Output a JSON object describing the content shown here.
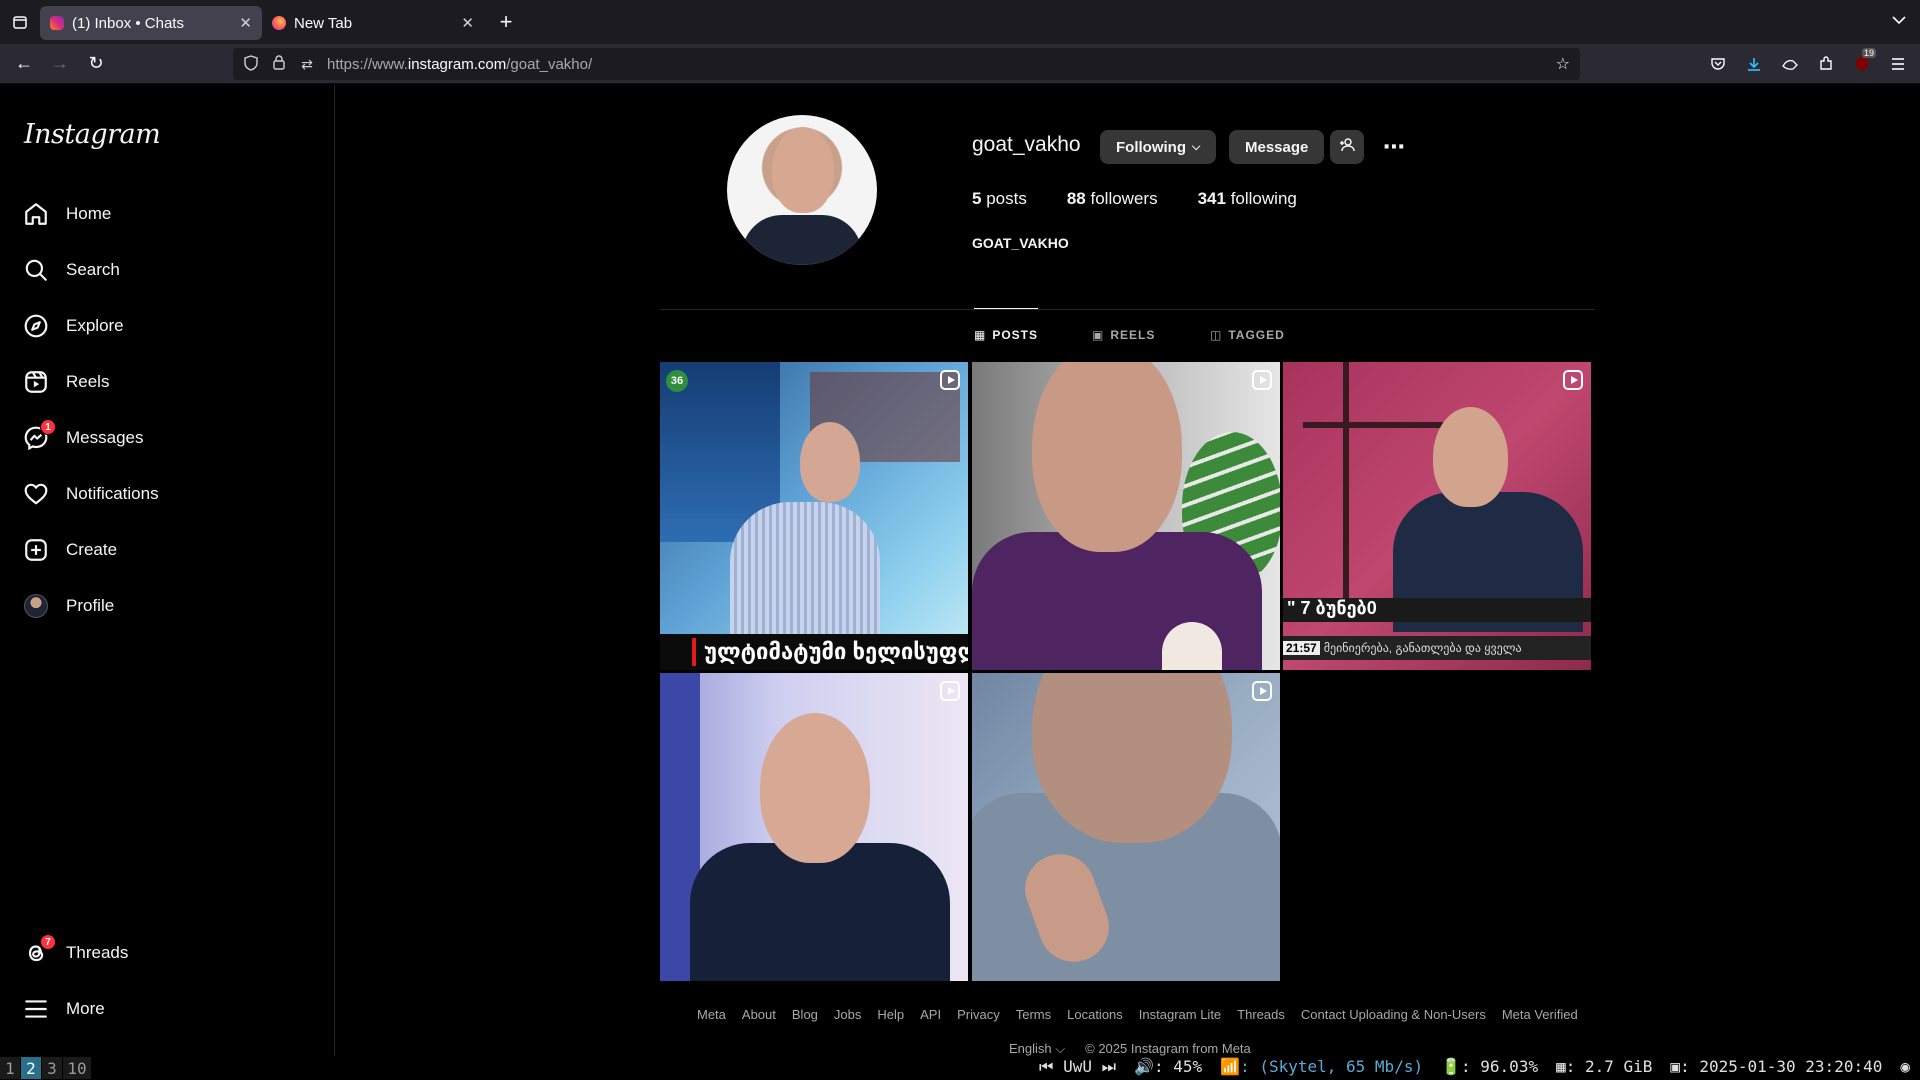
{
  "browser": {
    "tabs": [
      {
        "title": "(1) Inbox • Chats",
        "active": true
      },
      {
        "title": "New Tab",
        "active": false
      }
    ],
    "url_prefix": "https://www.",
    "url_domain": "instagram.com",
    "url_path": "/goat_vakho/",
    "extension_badge": "19"
  },
  "sidebar": {
    "logo": "Instagram",
    "items": [
      {
        "label": "Home",
        "icon": "home-icon"
      },
      {
        "label": "Search",
        "icon": "search-icon"
      },
      {
        "label": "Explore",
        "icon": "compass-icon"
      },
      {
        "label": "Reels",
        "icon": "reels-icon"
      },
      {
        "label": "Messages",
        "icon": "messenger-icon",
        "badge": "1"
      },
      {
        "label": "Notifications",
        "icon": "heart-icon"
      },
      {
        "label": "Create",
        "icon": "plus-square-icon"
      },
      {
        "label": "Profile",
        "icon": "profile-avatar"
      }
    ],
    "threads": {
      "label": "Threads",
      "badge": "7"
    },
    "more": {
      "label": "More"
    }
  },
  "profile": {
    "username": "goat_vakho",
    "following_btn": "Following",
    "message_btn": "Message",
    "posts_count": "5",
    "posts_label": "posts",
    "followers_count": "88",
    "followers_label": "followers",
    "following_count": "341",
    "following_label": "following",
    "full_name": "GOAT_VAKHO"
  },
  "profile_tabs": [
    {
      "label": "POSTS",
      "active": true
    },
    {
      "label": "REELS",
      "active": false
    },
    {
      "label": "TAGGED",
      "active": false
    }
  ],
  "posts": [
    {
      "caption": "ულტიმატუმი ხელისუფლ",
      "counter": "36",
      "reel": true
    },
    {
      "reel": true
    },
    {
      "caption": "\" 7 ბუნებ0",
      "subcaption": "მეინიერება, განათლება და ყველა",
      "time": "21:57",
      "reel": true
    },
    {
      "reel": true
    },
    {
      "reel": true
    }
  ],
  "footer": {
    "links": [
      "Meta",
      "About",
      "Blog",
      "Jobs",
      "Help",
      "API",
      "Privacy",
      "Terms",
      "Locations",
      "Instagram Lite",
      "Threads",
      "Contact Uploading & Non-Users",
      "Meta Verified"
    ],
    "language": "English",
    "copyright": "© 2025 Instagram from Meta"
  },
  "statusbar": {
    "workspaces": [
      "1",
      "2",
      "3",
      "10"
    ],
    "active_workspace": "2",
    "media": "UwU",
    "volume": ": 45%",
    "network": ": (Skytel, 65 Mb/s)",
    "battery": ": 96.03%",
    "memory": ": 2.7 GiB",
    "datetime": ": 2025-01-30 23:20:40"
  }
}
